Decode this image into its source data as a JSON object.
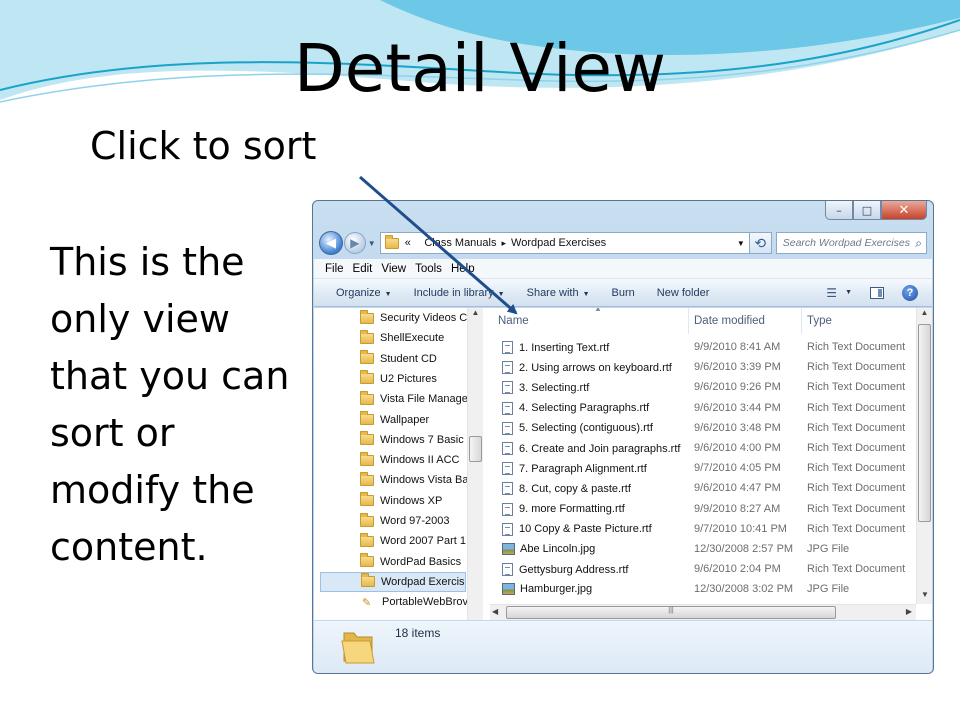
{
  "slide": {
    "title": "Detail View",
    "subtitle": "Click to sort",
    "body": "This is the only view that you can sort or modify the content."
  },
  "window": {
    "controls": {
      "minimize": "–",
      "maximize": "□",
      "close": "✕"
    },
    "address": {
      "prefix": "«",
      "crumbs": [
        "Class Manuals",
        "Wordpad Exercises"
      ],
      "separator": "▸"
    },
    "search_placeholder": "Search Wordpad Exercises",
    "menu": [
      "File",
      "Edit",
      "View",
      "Tools",
      "Help"
    ],
    "commands": [
      "Organize",
      "Include in library",
      "Share with",
      "Burn",
      "New folder"
    ],
    "nav_items": [
      {
        "label": "Security Videos C",
        "icon": "folder-icon"
      },
      {
        "label": "ShellExecute",
        "icon": "folder-icon"
      },
      {
        "label": "Student CD",
        "icon": "folder-icon"
      },
      {
        "label": "U2 Pictures",
        "icon": "folder-icon"
      },
      {
        "label": "Vista File Manage",
        "icon": "folder-icon"
      },
      {
        "label": "Wallpaper",
        "icon": "folder-icon"
      },
      {
        "label": "Windows 7 Basic",
        "icon": "folder-icon"
      },
      {
        "label": "Windows II ACC",
        "icon": "folder-icon"
      },
      {
        "label": "Windows Vista Ba",
        "icon": "folder-icon"
      },
      {
        "label": "Windows XP",
        "icon": "folder-icon"
      },
      {
        "label": "Word 97-2003",
        "icon": "folder-icon"
      },
      {
        "label": "Word 2007 Part 1",
        "icon": "folder-icon"
      },
      {
        "label": "WordPad Basics",
        "icon": "folder-icon"
      },
      {
        "label": "Wordpad Exercise",
        "icon": "folder-icon",
        "selected": true
      },
      {
        "label": "PortableWebBrov",
        "icon": "app-icon"
      }
    ],
    "columns": {
      "name": "Name",
      "date": "Date modified",
      "type": "Type"
    },
    "files": [
      {
        "name": "1. Inserting Text.rtf",
        "date": "9/9/2010 8:41 AM",
        "type": "Rich Text Document",
        "icon": "rtf-icon"
      },
      {
        "name": "2. Using arrows on keyboard.rtf",
        "date": "9/6/2010 3:39 PM",
        "type": "Rich Text Document",
        "icon": "rtf-icon"
      },
      {
        "name": "3. Selecting.rtf",
        "date": "9/6/2010 9:26 PM",
        "type": "Rich Text Document",
        "icon": "rtf-icon"
      },
      {
        "name": "4. Selecting Paragraphs.rtf",
        "date": "9/6/2010 3:44 PM",
        "type": "Rich Text Document",
        "icon": "rtf-icon"
      },
      {
        "name": "5. Selecting (contiguous).rtf",
        "date": "9/6/2010 3:48 PM",
        "type": "Rich Text Document",
        "icon": "rtf-icon"
      },
      {
        "name": "6. Create and Join paragraphs.rtf",
        "date": "9/6/2010 4:00 PM",
        "type": "Rich Text Document",
        "icon": "rtf-icon"
      },
      {
        "name": "7. Paragraph Alignment.rtf",
        "date": "9/7/2010 4:05 PM",
        "type": "Rich Text Document",
        "icon": "rtf-icon"
      },
      {
        "name": "8. Cut, copy & paste.rtf",
        "date": "9/6/2010 4:47 PM",
        "type": "Rich Text Document",
        "icon": "rtf-icon"
      },
      {
        "name": "9. more Formatting.rtf",
        "date": "9/9/2010 8:27 AM",
        "type": "Rich Text Document",
        "icon": "rtf-icon"
      },
      {
        "name": "10 Copy & Paste Picture.rtf",
        "date": "9/7/2010 10:41 PM",
        "type": "Rich Text Document",
        "icon": "rtf-icon"
      },
      {
        "name": "Abe Lincoln.jpg",
        "date": "12/30/2008 2:57 PM",
        "type": "JPG File",
        "icon": "jpg-icon"
      },
      {
        "name": "Gettysburg Address.rtf",
        "date": "9/6/2010 2:04 PM",
        "type": "Rich Text Document",
        "icon": "rtf-icon"
      },
      {
        "name": "Hamburger.jpg",
        "date": "12/30/2008 3:02 PM",
        "type": "JPG File",
        "icon": "jpg-icon"
      }
    ],
    "status": "18 items"
  },
  "colors": {
    "arrow": "#1f4e8c",
    "window_frame": "#b9d2ea",
    "selection": "#d9e8f7"
  }
}
